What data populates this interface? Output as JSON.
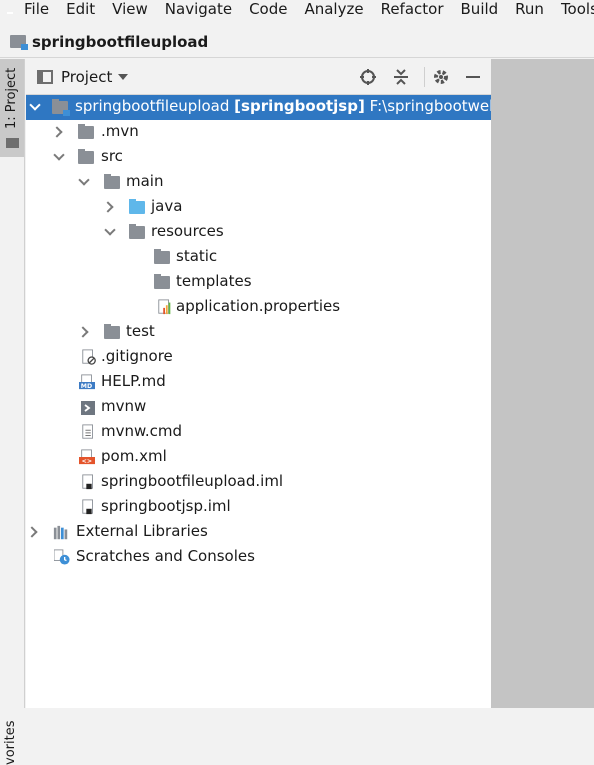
{
  "menubar": {
    "items": [
      "File",
      "Edit",
      "View",
      "Navigate",
      "Code",
      "Analyze",
      "Refactor",
      "Build",
      "Run",
      "Tools"
    ]
  },
  "navbar": {
    "title": "springbootfileupload"
  },
  "left_strip": {
    "project_tab": "1: Project",
    "favorites_tab": "vorites"
  },
  "panel": {
    "title": "Project",
    "buttons": [
      "locate-icon",
      "collapse-all-icon",
      "gear-icon",
      "minimize-icon"
    ]
  },
  "tree": {
    "root_name": "springbootfileupload",
    "root_module": "[springbootjsp]",
    "root_path": "F:\\springbootweb",
    "mvn": ".mvn",
    "src": "src",
    "main": "main",
    "java": "java",
    "resources": "resources",
    "static": "static",
    "templates": "templates",
    "application": "application.properties",
    "test": "test",
    "gitignore": ".gitignore",
    "help": "HELP.md",
    "mvnw": "mvnw",
    "mvnwcmd": "mvnw.cmd",
    "pom": "pom.xml",
    "iml1": "springbootfileupload.iml",
    "iml2": "springbootjsp.iml",
    "ext": "External Libraries",
    "scratch": "Scratches and Consoles"
  },
  "colors": {
    "selection": "#2f77c2",
    "folder": "#8a8f96",
    "source_folder": "#5fb7ea"
  }
}
